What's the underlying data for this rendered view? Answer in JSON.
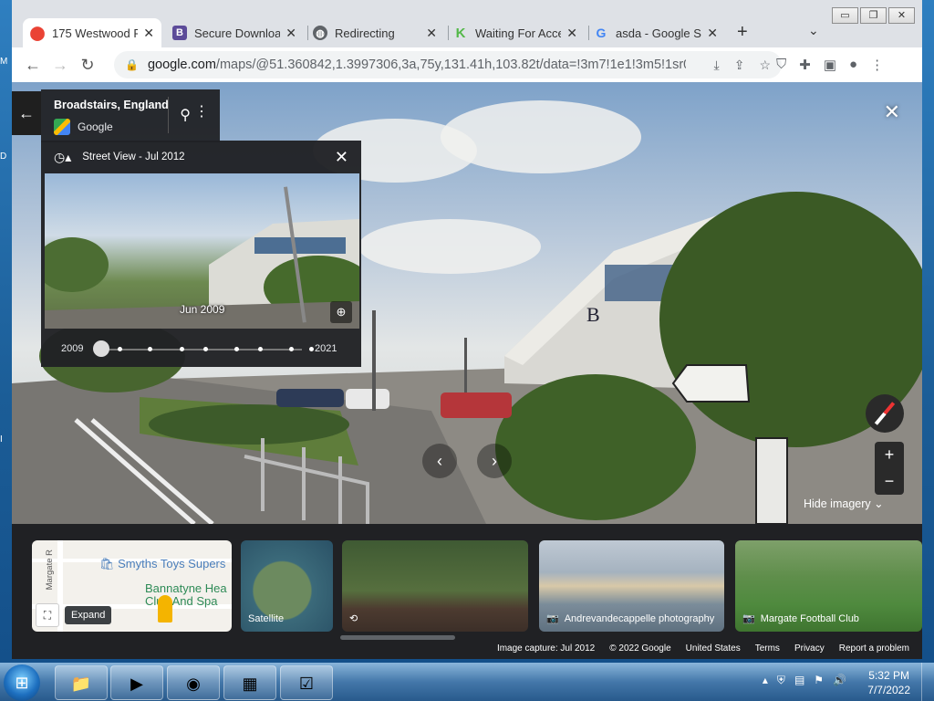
{
  "browser": {
    "tabs": [
      {
        "title": "175 Westwood R",
        "favicon": "maps-pin-icon",
        "color": "#34a853",
        "active": true
      },
      {
        "title": "Secure Downloac",
        "favicon": "b-icon",
        "color": "#5c4b99",
        "active": false
      },
      {
        "title": "Redirecting",
        "favicon": "globe-icon",
        "color": "#5f6368",
        "active": false
      },
      {
        "title": "Waiting For Acce",
        "favicon": "k-icon",
        "color": "#53b848",
        "active": false
      },
      {
        "title": "asda - Google Se",
        "favicon": "google-icon",
        "color": "#4285f4",
        "active": false
      }
    ],
    "new_tab": "+",
    "tab_search": "⌄",
    "window_controls": [
      "▭",
      "❐",
      "✕"
    ],
    "url_host": "google.com",
    "url_rest": "/maps/@51.360842,1.3997306,3a,75y,131.41h,103.82t/data=!3m7!1e1!3m5!1sr0..."
  },
  "streetview": {
    "location_title": "Broadstairs, England",
    "location_source": "Google",
    "time_machine": {
      "header": "Street View - Jul 2012",
      "preview_date": "Jun 2009",
      "year_start": "2009",
      "year_end": "2021",
      "selected_fraction": 0
    },
    "hide_imagery": "Hide imagery",
    "cards": [
      {
        "label": "Expand",
        "kind": "map"
      },
      {
        "label": "Satellite",
        "kind": "satellite"
      },
      {
        "label": "",
        "kind": "streetview"
      },
      {
        "label": "Andrevandecappelle photography",
        "kind": "photo"
      },
      {
        "label": "Margate Football Club",
        "kind": "photo"
      }
    ],
    "map_labels": {
      "poi1": "Smyths Toys Supers",
      "poi2_line1": "Bannatyne Hea",
      "poi2_line2": "Club And Spa",
      "road": "Margate R"
    },
    "footer": [
      "Image capture: Jul 2012",
      "© 2022 Google",
      "United States",
      "Terms",
      "Privacy",
      "Report a problem"
    ]
  },
  "taskbar": {
    "time": "5:32 PM",
    "date": "7/7/2022"
  }
}
